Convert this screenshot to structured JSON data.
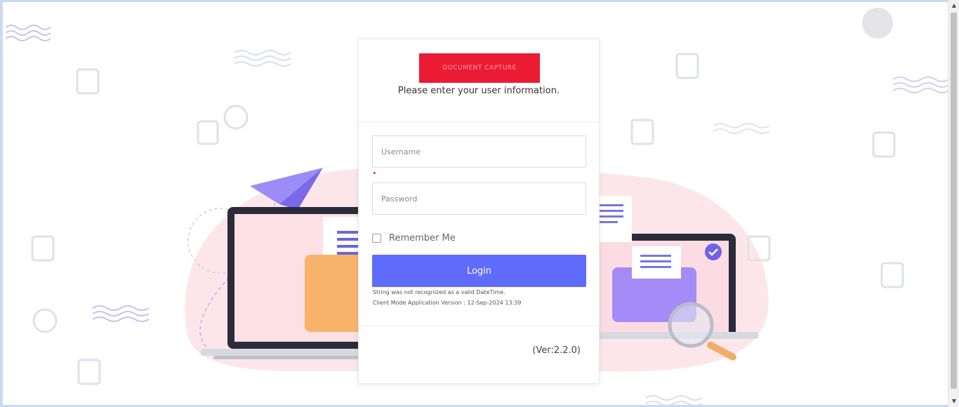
{
  "header": {
    "logo_text": "DOCUMENT CAPTURE",
    "subtitle": "Please enter your user information."
  },
  "form": {
    "username_placeholder": "Username",
    "password_placeholder": "Password",
    "remember_label": "Remember Me",
    "remember_checked": false,
    "login_label": "Login"
  },
  "messages": {
    "error": "String was not recognized as a valid DateTime.",
    "client_version": "Client Mode Application Version : 12-Sep-2024 13:39"
  },
  "footer": {
    "version": "(Ver:2.2.0)"
  },
  "colors": {
    "logo_bg": "#ea1b33",
    "button_bg": "#5f6bfa",
    "blob": "#fce3e7",
    "accent_purple": "#8f7df5",
    "folder_orange": "#f9b36b"
  }
}
